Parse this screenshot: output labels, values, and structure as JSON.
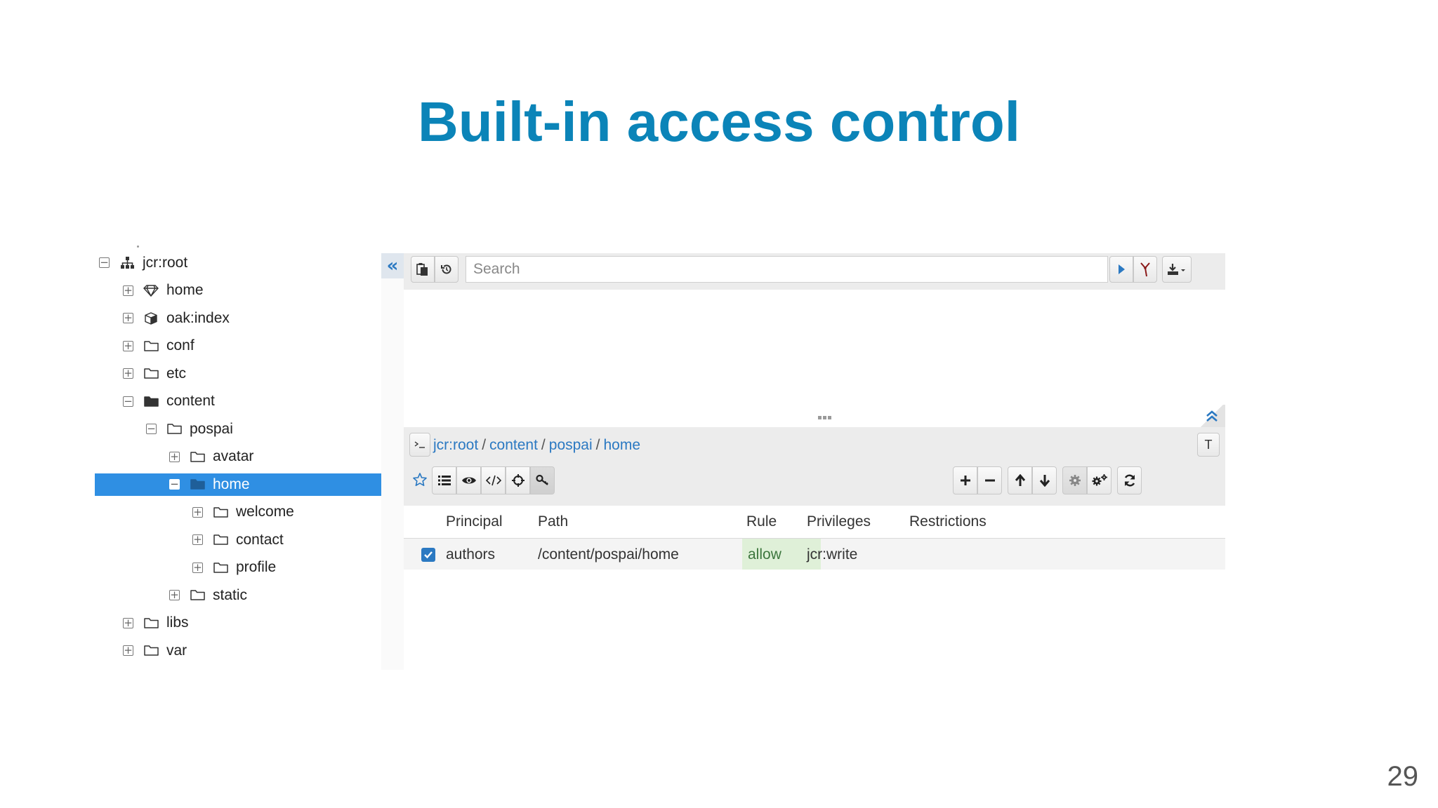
{
  "slide": {
    "title": "Built-in access control",
    "page_number": "29"
  },
  "tree": {
    "nodes": [
      {
        "label": "jcr:root",
        "toggle": "−",
        "icon": "sitemap-icon"
      },
      {
        "label": "home",
        "toggle": "+",
        "icon": "diamond-icon"
      },
      {
        "label": "oak:index",
        "toggle": "+",
        "icon": "cube-icon"
      },
      {
        "label": "conf",
        "toggle": "+",
        "icon": "folder-icon"
      },
      {
        "label": "etc",
        "toggle": "+",
        "icon": "folder-icon"
      },
      {
        "label": "content",
        "toggle": "−",
        "icon": "folder-open-icon"
      },
      {
        "label": "pospai",
        "toggle": "−",
        "icon": "folder-icon"
      },
      {
        "label": "avatar",
        "toggle": "+",
        "icon": "folder-icon"
      },
      {
        "label": "home",
        "toggle": "−",
        "icon": "folder-filled-icon"
      },
      {
        "label": "welcome",
        "toggle": "+",
        "icon": "folder-icon"
      },
      {
        "label": "contact",
        "toggle": "+",
        "icon": "folder-icon"
      },
      {
        "label": "profile",
        "toggle": "+",
        "icon": "folder-icon"
      },
      {
        "label": "static",
        "toggle": "+",
        "icon": "folder-icon"
      },
      {
        "label": "libs",
        "toggle": "+",
        "icon": "folder-icon"
      },
      {
        "label": "var",
        "toggle": "+",
        "icon": "folder-icon"
      }
    ],
    "selected_label": "home"
  },
  "toolbar": {
    "collapse_left_glyph": "«",
    "search_placeholder": "Search",
    "tenant_label": "T"
  },
  "breadcrumb": {
    "items": [
      "jcr:root",
      "content",
      "pospai",
      "home"
    ],
    "separator": "/"
  },
  "acl_table": {
    "columns": [
      "Principal",
      "Path",
      "Rule",
      "Privileges",
      "Restrictions"
    ],
    "rows": [
      {
        "principal": "authors",
        "path": "/content/pospai/home",
        "rule": "allow",
        "privileges": "jcr:write",
        "restrictions": "",
        "checked": true
      }
    ]
  },
  "colors": {
    "title": "#0b84b8",
    "selection": "#2f8fe3",
    "link": "#2b79c2",
    "allow_bg": "#dff0d8"
  }
}
